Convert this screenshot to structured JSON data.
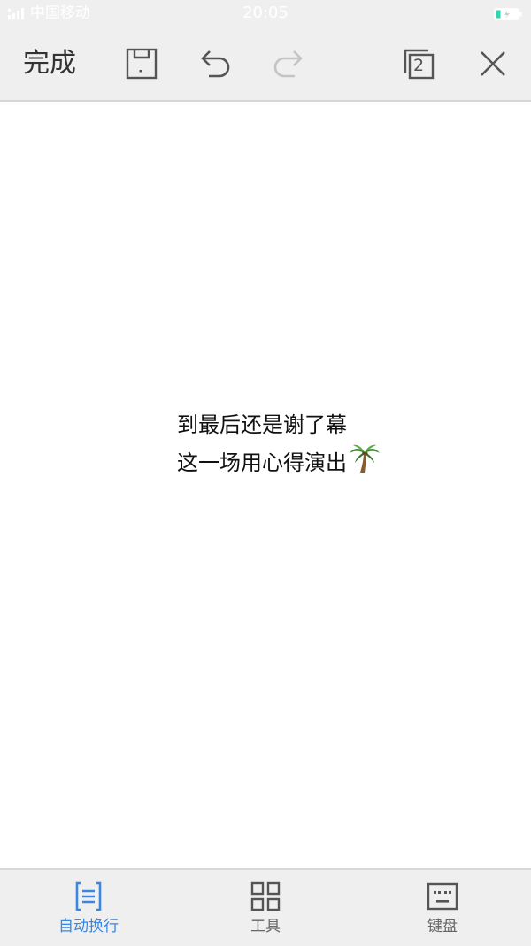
{
  "status_bar": {
    "carrier": "中国移动",
    "time": "20:05"
  },
  "toolbar": {
    "done_label": "完成",
    "page_count": "2",
    "icons": {
      "save": "save-icon",
      "undo": "undo-icon",
      "redo": "redo-icon",
      "pages": "pages-icon",
      "close": "close-icon"
    }
  },
  "content": {
    "lines": [
      "到最后还是谢了幕",
      "这一场用心得演出"
    ],
    "emoji": "palm-tree-icon"
  },
  "bottom_bar": {
    "items": [
      {
        "label": "自动换行",
        "icon": "wrap-text-icon",
        "active": true
      },
      {
        "label": "工具",
        "icon": "grid-tools-icon",
        "active": false
      },
      {
        "label": "键盘",
        "icon": "keyboard-icon",
        "active": false
      }
    ]
  },
  "colors": {
    "accent": "#3a86e0",
    "toolbar_bg": "#efefef",
    "battery": "#2bd6b0"
  }
}
